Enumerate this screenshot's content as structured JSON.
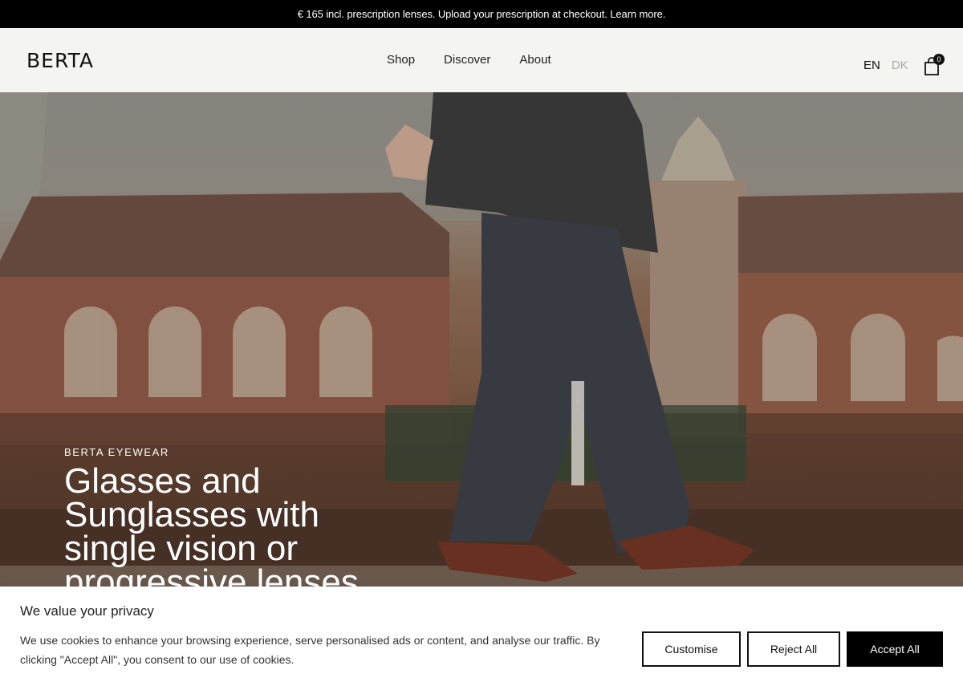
{
  "announcement": "€ 165 incl. prescription lenses. Upload your prescription at checkout. Learn more.",
  "header": {
    "logo": "BERTA",
    "nav": [
      "Shop",
      "Discover",
      "About"
    ],
    "lang_active": "EN",
    "lang_inactive": "DK",
    "cart_icon": "shopping-bag-icon",
    "cart_count": "0"
  },
  "hero": {
    "eyebrow": "BERTA EYEWEAR",
    "headline": "Glasses and Sunglasses with single vision or progressive lenses"
  },
  "cookie": {
    "title": "We value your privacy",
    "body": "We use cookies to enhance your browsing experience, serve personalised ads or content, and analyse our traffic. By clicking \"Accept All\", you consent to our use of cookies.",
    "customise_label": "Customise",
    "reject_label": "Reject All",
    "accept_label": "Accept All"
  },
  "colors": {
    "announcement_bg": "#000000",
    "header_bg": "#f4f4f0",
    "accept_bg": "#000000"
  }
}
